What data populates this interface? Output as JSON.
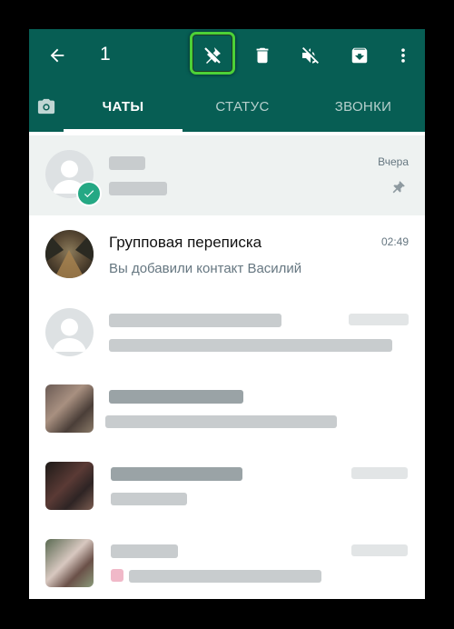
{
  "toolbar": {
    "selected_count": "1",
    "icons": [
      "back-arrow-icon",
      "unpin-icon",
      "delete-icon",
      "mute-icon",
      "archive-icon",
      "more-vert-icon"
    ]
  },
  "tabs": [
    {
      "label": "ЧАТЫ",
      "active": true
    },
    {
      "label": "СТАТУС",
      "active": false
    },
    {
      "label": "ЗВОНКИ",
      "active": false
    }
  ],
  "chats": [
    {
      "name": "",
      "message": "",
      "time": "Вчера",
      "selected": true,
      "pinned": true
    },
    {
      "name": "Групповая переписка",
      "message": "Вы добавили контакт Василий",
      "time": "02:49",
      "selected": false,
      "pinned": false
    }
  ],
  "colors": {
    "header": "#075e54",
    "accent": "#25a884",
    "highlight": "#4cd137"
  }
}
